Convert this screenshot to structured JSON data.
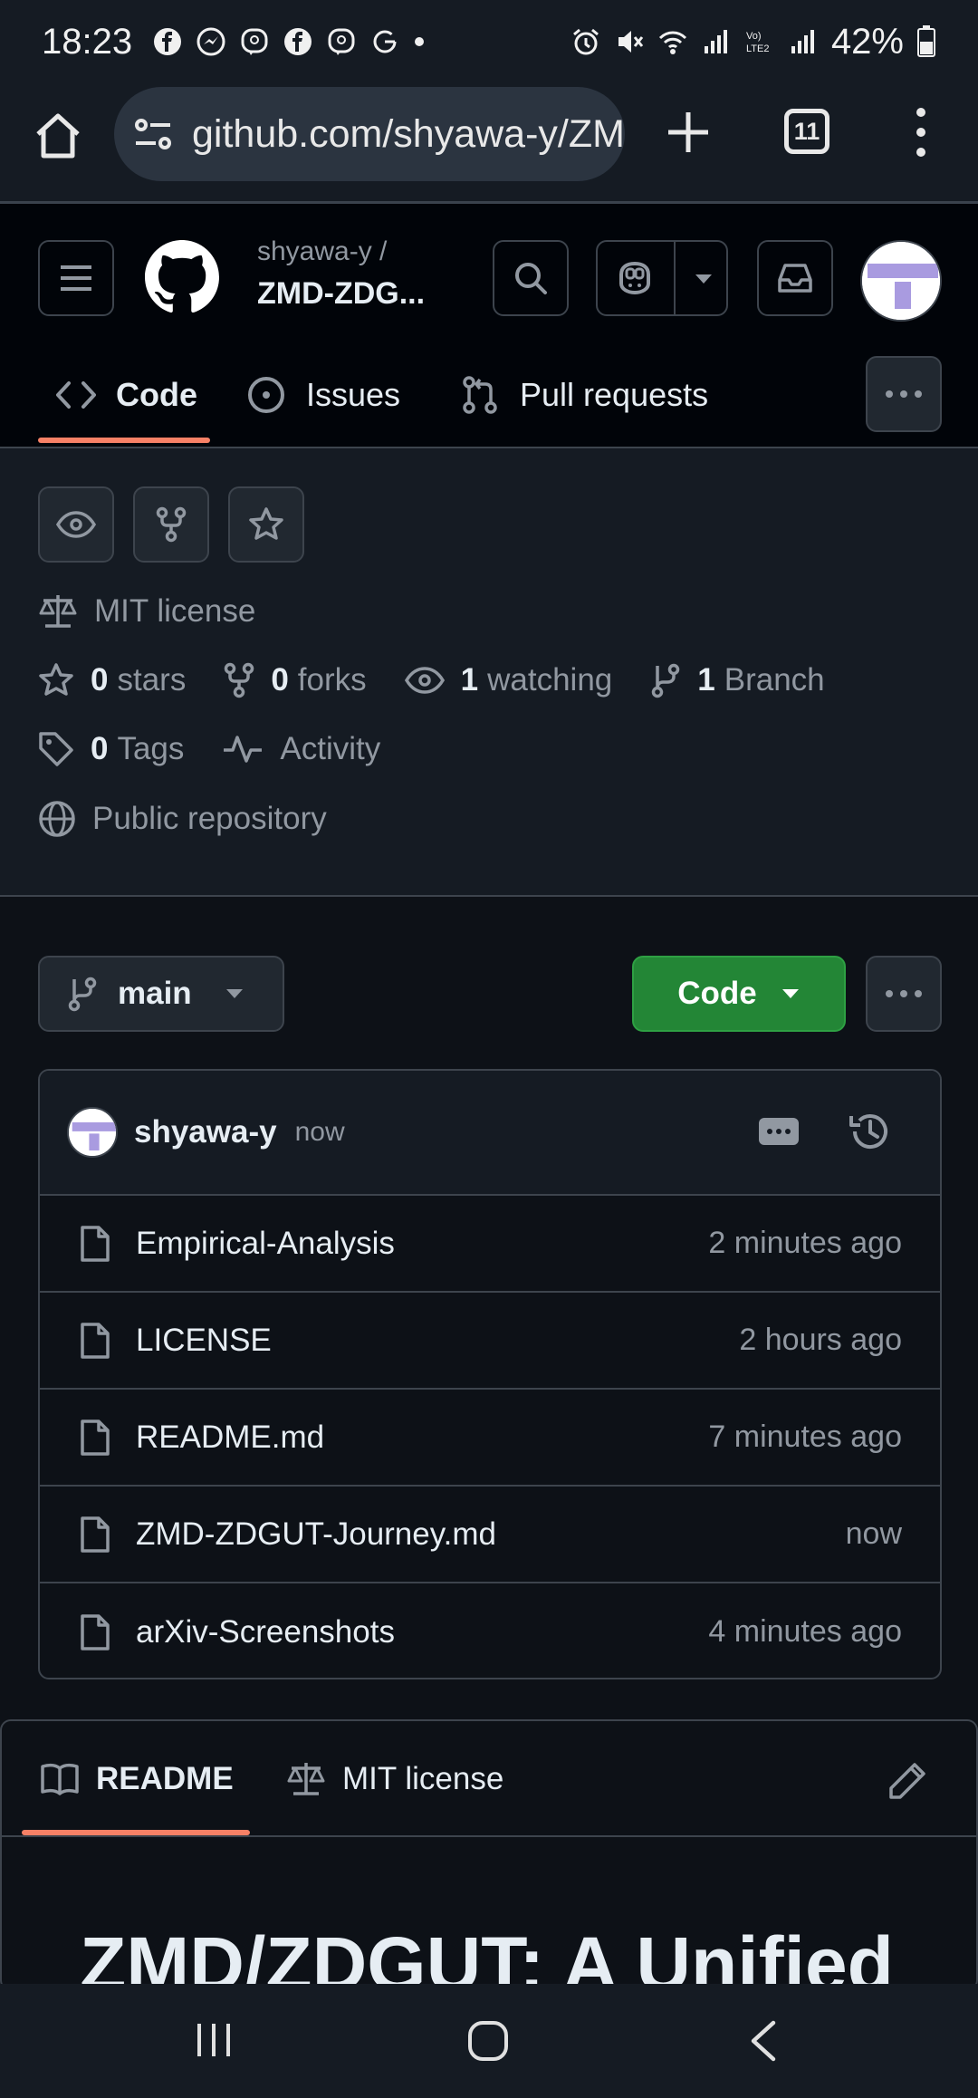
{
  "status_bar": {
    "time": "18:23",
    "battery": "42%",
    "notification_icons": [
      "facebook-icon",
      "messenger-icon",
      "viber-icon",
      "facebook-icon",
      "viber-icon",
      "google-icon"
    ]
  },
  "browser": {
    "url": "github.com/shyawa-y/ZMD-ZDGUT",
    "tab_count": "11"
  },
  "repo": {
    "owner": "shyawa-y /",
    "name": "ZMD-ZDG...",
    "tabs": [
      {
        "label": "Code",
        "icon": "code-icon"
      },
      {
        "label": "Issues",
        "icon": "issue-icon"
      },
      {
        "label": "Pull requests",
        "icon": "pull-request-icon"
      }
    ]
  },
  "meta": {
    "license": "MIT license",
    "stars_count": "0",
    "stars_label": "stars",
    "forks_count": "0",
    "forks_label": "forks",
    "watching_count": "1",
    "watching_label": "watching",
    "branch_count": "1",
    "branch_label": "Branch",
    "tags_count": "0",
    "tags_label": "Tags",
    "activity": "Activity",
    "visibility": "Public repository"
  },
  "branch_bar": {
    "branch": "main",
    "code_button": "Code"
  },
  "commit": {
    "user": "shyawa-y",
    "time": "now"
  },
  "files": [
    {
      "name": "Empirical-Analysis",
      "time": "2 minutes ago"
    },
    {
      "name": "LICENSE",
      "time": "2 hours ago"
    },
    {
      "name": "README.md",
      "time": "7 minutes ago"
    },
    {
      "name": "ZMD-ZDGUT-Journey.md",
      "time": "now"
    },
    {
      "name": "arXiv-Screenshots",
      "time": "4 minutes ago"
    }
  ],
  "readme": {
    "tab_readme": "README",
    "tab_license": "MIT license",
    "title": "ZMD/ZDGUT: A Unified"
  },
  "colors": {
    "accent_underline": "#f78166",
    "code_button": "#238636",
    "background": "#0d1117"
  }
}
